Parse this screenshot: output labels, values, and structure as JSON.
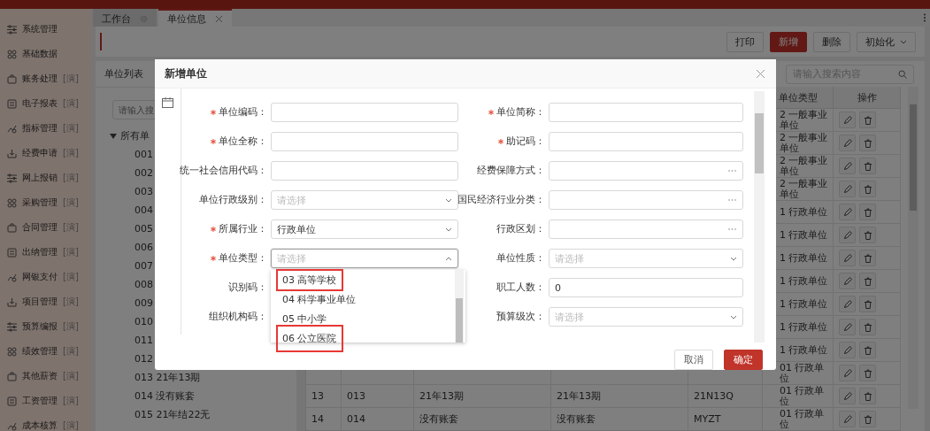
{
  "sidebar": {
    "items": [
      {
        "label": "系统管理"
      },
      {
        "label": "基础数据"
      },
      {
        "label": "账务处理",
        "badge": "[演]"
      },
      {
        "label": "电子报表",
        "badge": "[演]"
      },
      {
        "label": "指标管理",
        "badge": "[演]"
      },
      {
        "label": "经费申请",
        "badge": "[演]"
      },
      {
        "label": "网上报销",
        "badge": "[演]"
      },
      {
        "label": "采购管理",
        "badge": "[演]"
      },
      {
        "label": "合同管理",
        "badge": "[演]"
      },
      {
        "label": "出纳管理",
        "badge": "[演]"
      },
      {
        "label": "网银支付",
        "badge": "[演]"
      },
      {
        "label": "项目管理",
        "badge": "[演]"
      },
      {
        "label": "预算编报",
        "badge": "[演]"
      },
      {
        "label": "绩效管理",
        "badge": "[演]"
      },
      {
        "label": "其他薪资",
        "badge": "[演]"
      },
      {
        "label": "工资管理",
        "badge": "[演]"
      },
      {
        "label": "成本核算",
        "badge": "[演]"
      }
    ]
  },
  "tabs": [
    {
      "label": "工作台",
      "selected": false,
      "closable": false
    },
    {
      "label": "单位信息",
      "selected": true,
      "closable": true
    }
  ],
  "toolbar": {
    "buttons": [
      {
        "label": "打印",
        "primary": false,
        "dropdown": false
      },
      {
        "label": "新增",
        "primary": true,
        "dropdown": false
      },
      {
        "label": "删除",
        "primary": false,
        "dropdown": false
      },
      {
        "label": "初始化",
        "primary": false,
        "dropdown": true
      }
    ]
  },
  "unit_list": {
    "title": "单位列表",
    "search": {
      "placeholder": "请输入搜"
    },
    "tree": {
      "label": "所有单",
      "expanded": true,
      "children": [
        {
          "label": "001"
        },
        {
          "label": "002"
        },
        {
          "label": "003"
        },
        {
          "label": "004"
        },
        {
          "label": "005"
        },
        {
          "label": "006"
        },
        {
          "label": "007"
        },
        {
          "label": "008"
        },
        {
          "label": "009"
        },
        {
          "label": "010"
        },
        {
          "label": "011"
        },
        {
          "label": "012"
        },
        {
          "label": "013 21年13期"
        },
        {
          "label": "014 没有账套"
        },
        {
          "label": "015 21年结22无"
        }
      ]
    }
  },
  "unit_table": {
    "search": {
      "placeholder": "请输入搜索内容"
    },
    "columns": [
      {
        "label": "单位类型"
      },
      {
        "label": "操作"
      }
    ],
    "rows": [
      {
        "type": "2 一般事业单位"
      },
      {
        "type": "2 一般事业单位"
      },
      {
        "type": "2 一般事业单位"
      },
      {
        "type": "2 一般事业单位"
      },
      {
        "type": "1 行政单位"
      },
      {
        "type": "1 行政单位"
      },
      {
        "type": "1 行政单位"
      },
      {
        "type": "1 行政单位"
      },
      {
        "type": "1 行政单位"
      },
      {
        "type": "1 行政单位"
      },
      {
        "type": "1 行政单位"
      },
      {
        "type": "01 行政单位"
      },
      {
        "column_1": "13",
        "column_2": "013",
        "column_3": "21年13期",
        "column_4": "21年13期",
        "column_5": "21N13Q",
        "type": "01 行政单位"
      },
      {
        "column_1": "14",
        "column_2": "014",
        "column_3": "没有账套",
        "column_4": "没有账套",
        "column_5": "MYZT",
        "type": "01 行政单位"
      }
    ]
  },
  "dialog": {
    "title": "新增单位",
    "fields": [
      {
        "label": "单位编码：",
        "required": true,
        "kind": "text"
      },
      {
        "label": "单位简称：",
        "required": true,
        "kind": "text"
      },
      {
        "label": "单位全称：",
        "required": true,
        "kind": "text"
      },
      {
        "label": "助记码：",
        "required": true,
        "kind": "text"
      },
      {
        "label": "统一社会信用代码：",
        "required": false,
        "kind": "text"
      },
      {
        "label": "经费保障方式：",
        "required": false,
        "kind": "picker"
      },
      {
        "label": "单位行政级别：",
        "required": false,
        "kind": "select",
        "placeholder": "请选择",
        "open": false
      },
      {
        "label": "国民经济行业分类：",
        "required": false,
        "kind": "picker"
      },
      {
        "label": "所属行业：",
        "required": true,
        "kind": "select",
        "value": "行政单位",
        "open": false
      },
      {
        "label": "行政区划：",
        "required": false,
        "kind": "picker"
      },
      {
        "label": "单位类型：",
        "required": true,
        "kind": "select",
        "placeholder": "请选择",
        "open": true,
        "options": [
          {
            "label": "03 高等学校",
            "annotated": true
          },
          {
            "label": "04 科学事业单位",
            "annotated": false
          },
          {
            "label": "05 中小学",
            "annotated": false
          },
          {
            "label": "06 公立医院",
            "annotated": true
          }
        ]
      },
      {
        "label": "单位性质：",
        "required": false,
        "kind": "select",
        "placeholder": "请选择",
        "open": false
      },
      {
        "label": "识别码：",
        "required": false,
        "kind": "text"
      },
      {
        "label": "职工人数：",
        "required": false,
        "kind": "text",
        "value": "0"
      },
      {
        "label": "组织机构码：",
        "required": false,
        "kind": "text"
      },
      {
        "label": "预算级次：",
        "required": false,
        "kind": "select",
        "placeholder": "请选择",
        "open": false
      }
    ],
    "buttons": [
      {
        "label": "取消",
        "primary": false
      },
      {
        "label": "确定",
        "primary": true
      }
    ]
  }
}
